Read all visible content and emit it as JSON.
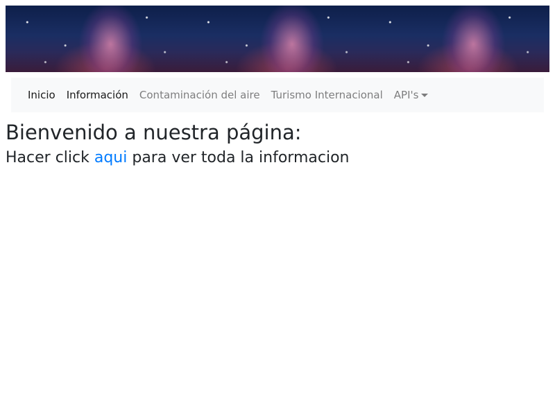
{
  "banner": {
    "image": "starry-milky-way-banner"
  },
  "navbar": {
    "items": [
      {
        "label": "Inicio",
        "active": true
      },
      {
        "label": "Información",
        "active": true
      },
      {
        "label": "Contaminación del aire",
        "active": false
      },
      {
        "label": "Turismo Internacional",
        "active": false
      },
      {
        "label": "API's",
        "active": false,
        "dropdown": true
      }
    ]
  },
  "main": {
    "heading": "Bienvenido a nuestra página:",
    "subheading_before": "Hacer click ",
    "subheading_link": "aqui",
    "subheading_after": " para ver toda la informacion"
  },
  "colors": {
    "link": "#007bff",
    "navbar_bg": "#f8f9fa",
    "text": "#212529"
  }
}
